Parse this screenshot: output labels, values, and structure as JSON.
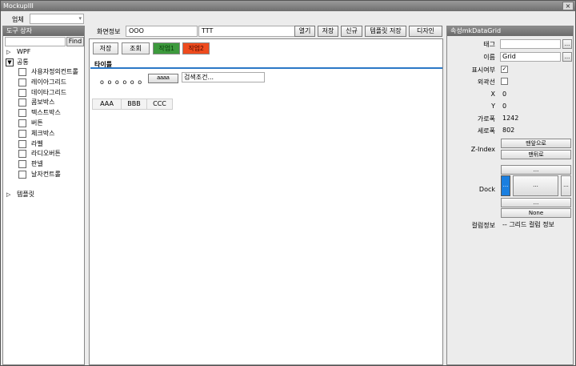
{
  "window": {
    "title": "MockupIII",
    "close_label": "×"
  },
  "company": {
    "label": "업체",
    "value": "",
    "arrow": "▾"
  },
  "toolbox": {
    "header": "도구 상자",
    "find_label": "Find",
    "find_value": "",
    "groups": [
      {
        "label": "WPF",
        "expanded": false,
        "toggle": "▷"
      },
      {
        "label": "공통",
        "expanded": true,
        "toggle": "▼"
      }
    ],
    "items": [
      "사용자정의컨트롤",
      "레이아그리드",
      "데이타그리드",
      "콤보박스",
      "텍스트박스",
      "버튼",
      "체크박스",
      "라벨",
      "라디오버튼",
      "판넬",
      "날자컨트롤"
    ],
    "template_group": {
      "label": "템플릿",
      "toggle": "▷"
    }
  },
  "screen_info": {
    "label": "화면정보",
    "value1": "OOO",
    "value2": "TTT",
    "buttons": [
      "열기",
      "저장",
      "신규",
      "템플릿 저장",
      "디자인"
    ]
  },
  "design": {
    "buttons": [
      {
        "label": "저장",
        "style": "normal"
      },
      {
        "label": "조회",
        "style": "normal"
      },
      {
        "label": "작업1",
        "style": "green",
        "color": "#3d9a3d"
      },
      {
        "label": "작업2",
        "style": "red",
        "color": "#ee4b1e"
      }
    ],
    "section_title": "타이틀",
    "accent_color": "#2b78c6",
    "dots_label": "o o o o o o",
    "aaaa_label": "aaaa",
    "search_value": "검색조건...",
    "grid_columns": [
      "AAA",
      "BBB",
      "CCC"
    ]
  },
  "properties": {
    "header": "속성mkDataGrid",
    "tag": {
      "label": "태그",
      "value": "",
      "btn": "..."
    },
    "name": {
      "label": "이름",
      "value": "Grid",
      "btn": "..."
    },
    "visible": {
      "label": "표시여부",
      "checked": true,
      "mark": "✓"
    },
    "border": {
      "label": "외곽선",
      "checked": false,
      "mark": ""
    },
    "x": {
      "label": "X",
      "value": "0"
    },
    "y": {
      "label": "Y",
      "value": "0"
    },
    "width": {
      "label": "가로폭",
      "value": "1242"
    },
    "height": {
      "label": "세로폭",
      "value": "802"
    },
    "zindex": {
      "label": "Z-Index",
      "front": "맨앞으로",
      "back": "맨뒤로"
    },
    "dock": {
      "label": "Dock",
      "top": "...",
      "left": "...",
      "fill": "...",
      "right": "...",
      "bottom": "...",
      "none": "None",
      "dock_color": "#1a7fe0"
    },
    "column_info": {
      "label": "컬럼정보",
      "value": "-- 그리드 컬럼 정보"
    }
  }
}
